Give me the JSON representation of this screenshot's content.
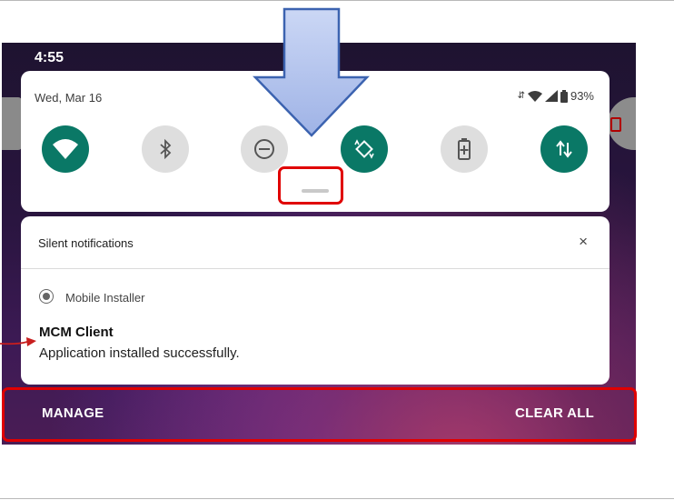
{
  "status_bar": {
    "time": "4:55"
  },
  "quick_settings": {
    "date": "Wed, Mar 16",
    "battery": "93%",
    "tiles": [
      {
        "name": "wifi",
        "state": "on"
      },
      {
        "name": "bluetooth",
        "state": "off"
      },
      {
        "name": "do-not-disturb",
        "state": "off"
      },
      {
        "name": "auto-rotate",
        "state": "on"
      },
      {
        "name": "battery-saver",
        "state": "off"
      },
      {
        "name": "mobile-data",
        "state": "on"
      }
    ]
  },
  "notification": {
    "section_title": "Silent notifications",
    "close_symbol": "×",
    "app_name": "Mobile Installer",
    "title": "MCM Client",
    "text": "Application installed successfully."
  },
  "footer": {
    "manage_label": "MANAGE",
    "clear_all_label": "CLEAR ALL"
  },
  "colors": {
    "tile_on": "#0a7866",
    "tile_off": "#dedede",
    "highlight": "#e00000",
    "arrow": "#b7c8ee"
  }
}
